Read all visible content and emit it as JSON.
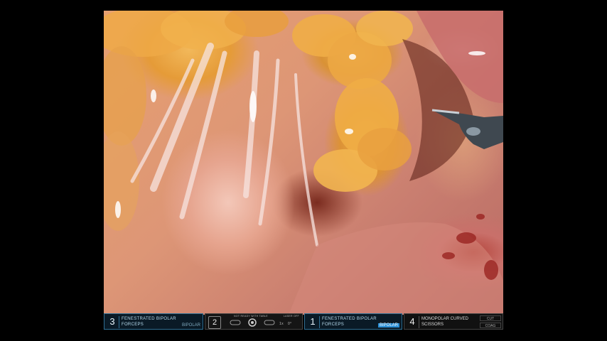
{
  "arms": [
    {
      "number": "3",
      "instrument": "FENESTRATED BIPOLAR\nFORCEPS",
      "mode": "BIPOLAR"
    },
    {
      "number": "1",
      "instrument": "FENESTRATED BIPOLAR\nFORCEPS",
      "mode": "BIPOLAR"
    },
    {
      "number": "4",
      "instrument": "MONOPOLAR CURVED\nSCISSORS",
      "energy": [
        "CUT",
        "COAG"
      ]
    }
  ],
  "camera": {
    "number": "2",
    "status": "NOT READY WITH TABLE",
    "laser": "LASER OFF",
    "zoom": "1x",
    "angle": "0°"
  },
  "colors": {
    "hud_active": "#2a8fd6",
    "hud_border": "#2f6f94"
  }
}
